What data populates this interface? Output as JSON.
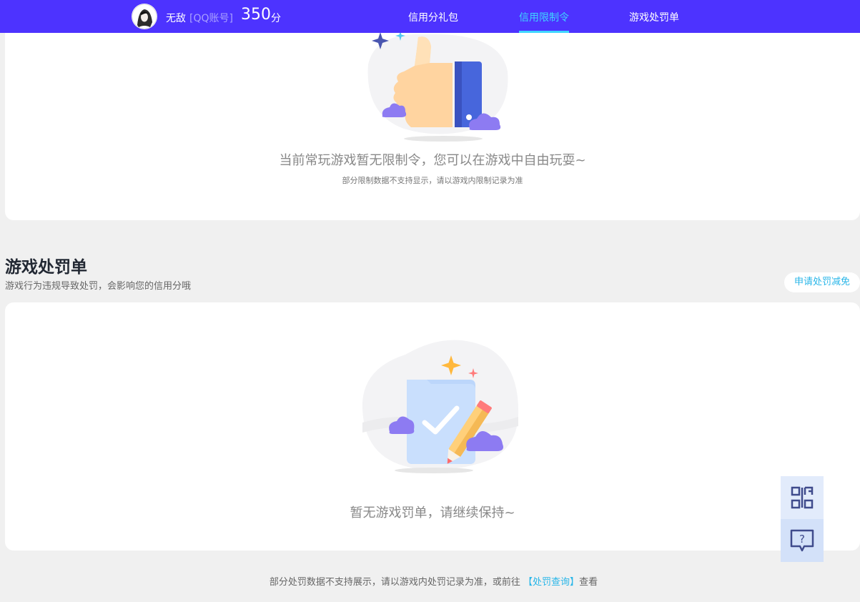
{
  "header": {
    "username": "无敌",
    "account_type": "[QQ账号]",
    "score": "350",
    "score_unit": "分",
    "nav": [
      {
        "label": "信用分礼包",
        "active": false
      },
      {
        "label": "信用限制令",
        "active": true
      },
      {
        "label": "游戏处罚单",
        "active": false
      }
    ]
  },
  "restriction": {
    "empty_text": "当前常玩游戏暂无限制令，您可以在游戏中自由玩耍~",
    "note": "部分限制数据不支持显示，请以游戏内限制记录为准"
  },
  "penalty": {
    "title": "游戏处罚单",
    "description": "游戏行为违规导致处罚，会影响您的信用分哦",
    "appeal_label": "申请处罚减免",
    "empty_text": "暂无游戏罚单，请继续保持~"
  },
  "footer": {
    "note_prefix": "部分处罚数据不支持展示，请以游戏内处罚记录为准，或前往 ",
    "link_label": "【处罚查询】",
    "note_suffix": "查看"
  },
  "floating": {
    "qr_icon": "qr-code-icon",
    "help_icon": "help-chat-icon"
  },
  "colors": {
    "nav_bg": "#4d33ff",
    "nav_active": "#3fd6ff",
    "link": "#29b6e8"
  }
}
